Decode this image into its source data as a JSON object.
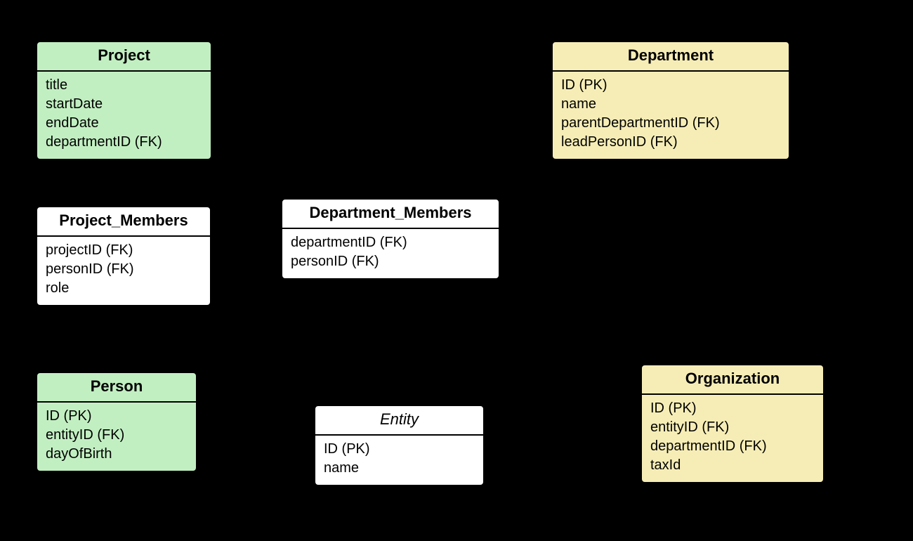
{
  "colors": {
    "green": "#c2efc2",
    "yellow": "#f6edb6",
    "white": "#ffffff",
    "border": "#000000",
    "bg": "#000000"
  },
  "entities": {
    "project": {
      "title": "Project",
      "attrs": [
        "title",
        "startDate",
        "endDate",
        "departmentID (FK)"
      ],
      "fill": "green"
    },
    "department": {
      "title": "Department",
      "attrs": [
        "ID (PK)",
        "name",
        "parentDepartmentID (FK)",
        "leadPersonID (FK)"
      ],
      "fill": "yellow"
    },
    "project_members": {
      "title": "Project_Members",
      "attrs": [
        "projectID (FK)",
        "personID (FK)",
        "role"
      ],
      "fill": "white"
    },
    "department_members": {
      "title": "Department_Members",
      "attrs": [
        "departmentID (FK)",
        "personID (FK)"
      ],
      "fill": "white"
    },
    "person": {
      "title": "Person",
      "attrs": [
        "ID (PK)",
        "entityID (FK)",
        "dayOfBirth"
      ],
      "fill": "green"
    },
    "entity": {
      "title": "Entity",
      "attrs": [
        "ID (PK)",
        "name"
      ],
      "fill": "white",
      "italicTitle": true
    },
    "organization": {
      "title": "Organization",
      "attrs": [
        "ID (PK)",
        "entityID (FK)",
        "departmentID (FK)",
        "taxId"
      ],
      "fill": "yellow"
    }
  }
}
